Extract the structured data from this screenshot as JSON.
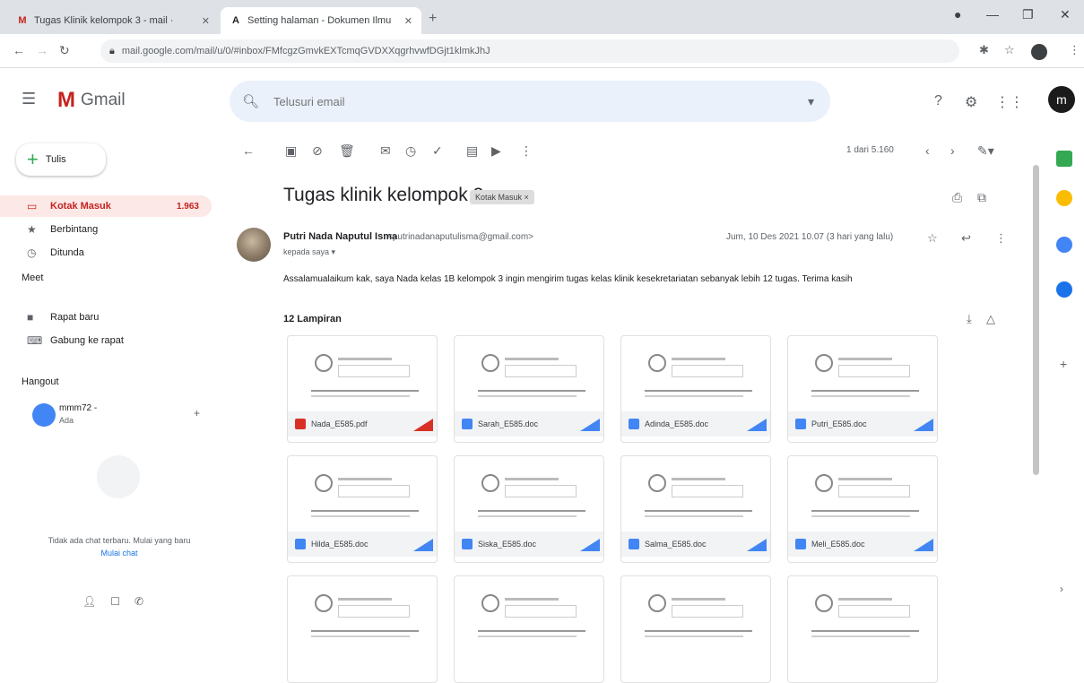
{
  "browser": {
    "tabs": [
      {
        "favicon": "M",
        "title": "Tugas Klinik kelompok 3 - mail ·"
      },
      {
        "favicon": "A",
        "title": "Setting halaman - Dokumen Ilmu"
      }
    ],
    "url": "mail.google.com/mail/u/0/#inbox/FMfcgzGmvkEXTcmqGVDXXqgrhvwfDGjt1klmkJhJ",
    "new_tab": "+",
    "minimize": "—",
    "maximize": "❐",
    "close": "✕"
  },
  "gmail": {
    "app_name": "Gmail",
    "search_placeholder": "Telusuri email",
    "avatar_letter": "m"
  },
  "sidebar": {
    "compose_label": "Tulis",
    "items": [
      {
        "label": "Kotak Masuk",
        "count": "1.963",
        "icon": "inbox-icon"
      },
      {
        "label": "Berbintang",
        "icon": "star-icon"
      },
      {
        "label": "Ditunda",
        "icon": "clock-icon"
      }
    ],
    "meet_label": "Meet",
    "meet_items": [
      {
        "label": "Rapat baru",
        "icon": "video-icon"
      },
      {
        "label": "Gabung ke rapat",
        "icon": "keyboard-icon"
      }
    ],
    "hangouts_label": "Hangout",
    "contact": {
      "name": "mmm72 -",
      "status": "Ada"
    },
    "empty_text": "Tidak ada chat terbaru. Mulai yang baru",
    "empty_link": "Mulai chat"
  },
  "toolbar": {
    "pager": "1 dari 5.160"
  },
  "email": {
    "subject": "Tugas klinik kelompok 3",
    "label": "Kotak Masuk ×",
    "sender_name": "Putri Nada Naputul Isma",
    "sender_email": "<putrinadanaputulisma@gmail.com>",
    "recipient": "kepada saya ▾",
    "date": "Jum, 10 Des 2021 10.07 (3 hari yang lalu)",
    "body": "Assalamualaikum kak, saya Nada kelas 1B kelompok 3 ingin mengirim tugas kelas klinik kesekretariatan sebanyak lebih 12 tugas. Terima kasih",
    "attachments_heading": "12 Lampiran",
    "attachments": [
      {
        "name": "Nada_E585.pdf",
        "type": "pdf"
      },
      {
        "name": "Sarah_E585.doc",
        "type": "doc"
      },
      {
        "name": "Adinda_E585.doc",
        "type": "doc"
      },
      {
        "name": "Putri_E585.doc",
        "type": "doc"
      },
      {
        "name": "Hilda_E585.doc",
        "type": "doc"
      },
      {
        "name": "Siska_E585.doc",
        "type": "doc"
      },
      {
        "name": "Salma_E585.doc",
        "type": "doc"
      },
      {
        "name": "Meli_E585.doc",
        "type": "doc"
      },
      {
        "name": "",
        "type": "doc"
      },
      {
        "name": "",
        "type": "doc"
      },
      {
        "name": "",
        "type": "doc"
      },
      {
        "name": "",
        "type": "doc"
      }
    ]
  },
  "colors": {
    "pdf": "#d93025",
    "doc": "#4285f4",
    "active_nav_bg": "#fce8e6",
    "accent_red": "#c5221f"
  }
}
